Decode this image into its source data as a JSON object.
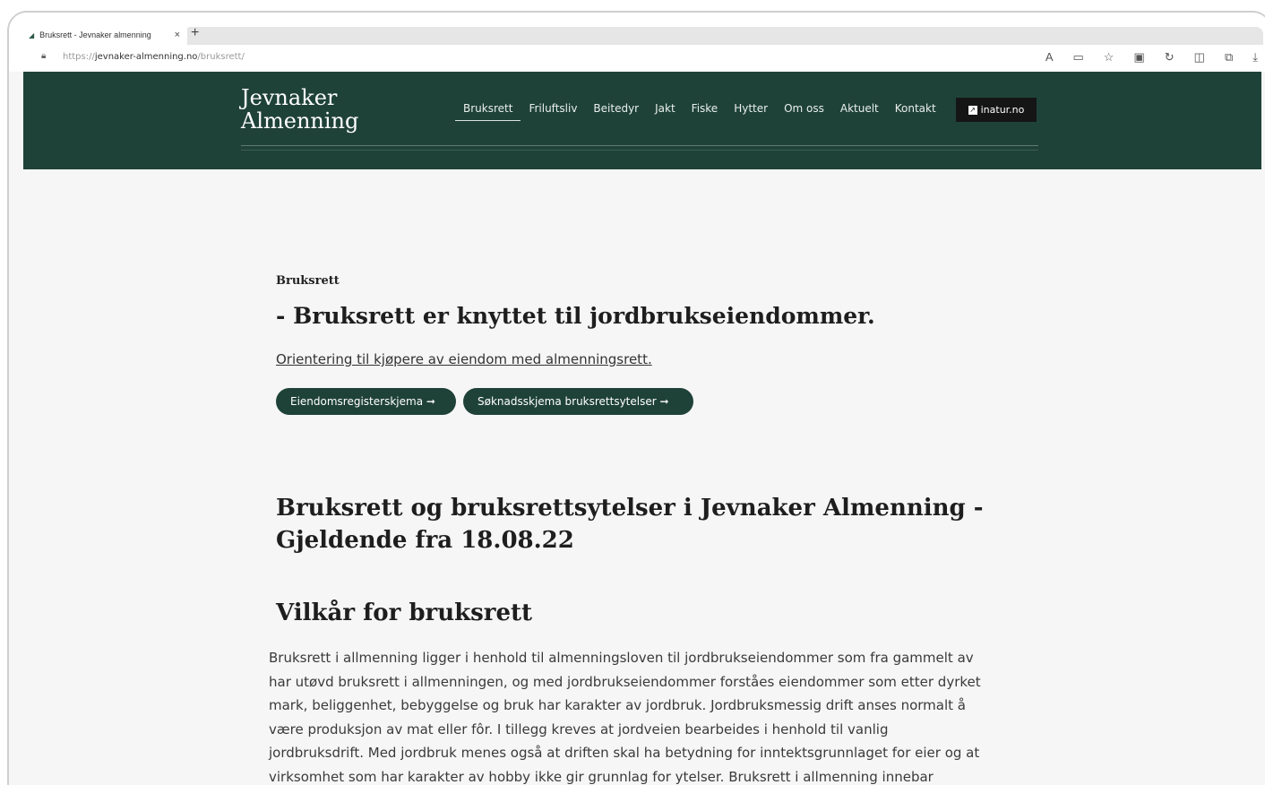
{
  "browser": {
    "tab_title": "Bruksrett - Jevnaker almenning",
    "url_scheme": "https://",
    "url_host": "jevnaker-almenning.no",
    "url_path": "/bruksrett/",
    "close_glyph": "×",
    "newtab_glyph": "+"
  },
  "site": {
    "logo_line1": "Jevnaker",
    "logo_line2": "Almenning",
    "nav": [
      "Bruksrett",
      "Friluftsliv",
      "Beitedyr",
      "Jakt",
      "Fiske",
      "Hytter",
      "Om oss",
      "Aktuelt",
      "Kontakt"
    ],
    "external_button": "inatur.no"
  },
  "page": {
    "eyebrow": "Bruksrett",
    "lead": "- Bruksrett er knyttet til jordbrukseiendommer.",
    "orientation_link": "Orientering til kjøpere av eiendom med almenningsrett.",
    "buttons": {
      "register": "Eiendomsregisterskjema ➞",
      "application": "Søknadsskjema bruksrettsytelser ➞"
    },
    "heading": "Bruksrett og bruksrettsytelser i Jevnaker Almenning - Gjeldende fra 18.08.22",
    "subheading": "Vilkår for bruksrett",
    "paragraph": "Bruksrett i allmenning ligger i henhold til almenningsloven til jordbrukseiendommer som fra gammelt av har utøvd bruksrett i allmenningen, og med jordbrukseiendommer forståes eiendommer som etter dyrket mark, beliggenhet, bebyggelse og bruk har karakter av jordbruk. Jordbruksmessig drift anses normalt å være produksjon av mat eller fôr. I tillegg kreves at jordveien bearbeides i henhold til vanlig jordbruksdrift. Med jordbruk menes også at driften skal ha betydning for inntektsgrunnlaget for eier og at virksomhet som har karakter av hobby ikke gir grunnlag for ytelser. Bruksrett i allmenning innebar tidligere bl.a. rett til uttak av"
  },
  "colors": {
    "header_bg": "#1f4238",
    "button_bg": "#1f4238",
    "page_bg": "#f6f6f6"
  }
}
